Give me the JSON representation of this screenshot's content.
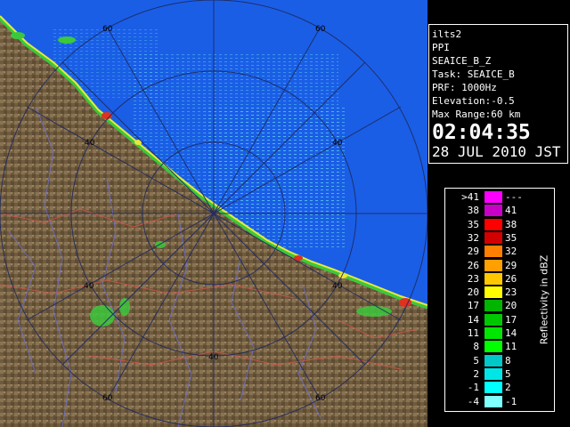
{
  "info": {
    "station": "ilts2",
    "product": "PPI",
    "product_code": "SEAICE_B_Z",
    "task": "Task: SEAICE_B",
    "prf": "PRF: 1000Hz",
    "elevation": "Elevation:-0.5",
    "max_range": "Max Range:60 km",
    "time": "02:04:35",
    "date": "28 JUL 2010 JST"
  },
  "legend": {
    "title": "Reflectivity in dBZ",
    "rows": [
      {
        "low": ">41",
        "high": "---",
        "color": "#ff00ff"
      },
      {
        "low": "38",
        "high": "41",
        "color": "#c800c8"
      },
      {
        "low": "35",
        "high": "38",
        "color": "#ff0000"
      },
      {
        "low": "32",
        "high": "35",
        "color": "#d20000"
      },
      {
        "low": "29",
        "high": "32",
        "color": "#ff8000"
      },
      {
        "low": "26",
        "high": "29",
        "color": "#ffa000"
      },
      {
        "low": "23",
        "high": "26",
        "color": "#ffc800"
      },
      {
        "low": "20",
        "high": "23",
        "color": "#ffff00"
      },
      {
        "low": "17",
        "high": "20",
        "color": "#00b400"
      },
      {
        "low": "14",
        "high": "17",
        "color": "#00c800"
      },
      {
        "low": "11",
        "high": "14",
        "color": "#00e600"
      },
      {
        "low": "8",
        "high": "11",
        "color": "#00ff00"
      },
      {
        "low": "5",
        "high": "8",
        "color": "#00c8c8"
      },
      {
        "low": "2",
        "high": "5",
        "color": "#00e6e6"
      },
      {
        "low": "-1",
        "high": "2",
        "color": "#00ffff"
      },
      {
        "low": "-4",
        "high": "-1",
        "color": "#80ffff"
      }
    ]
  },
  "map": {
    "ring_labels": [
      "60",
      "60",
      "40",
      "40",
      "40",
      "40",
      "40",
      "60",
      "60"
    ],
    "colors": {
      "sea": "#1a5ee6",
      "land": "#7b6647",
      "echo_light": "#5fd0e8",
      "echo_green": "#3cc83c",
      "echo_yellow": "#e8e83c",
      "echo_red": "#e03020"
    }
  }
}
